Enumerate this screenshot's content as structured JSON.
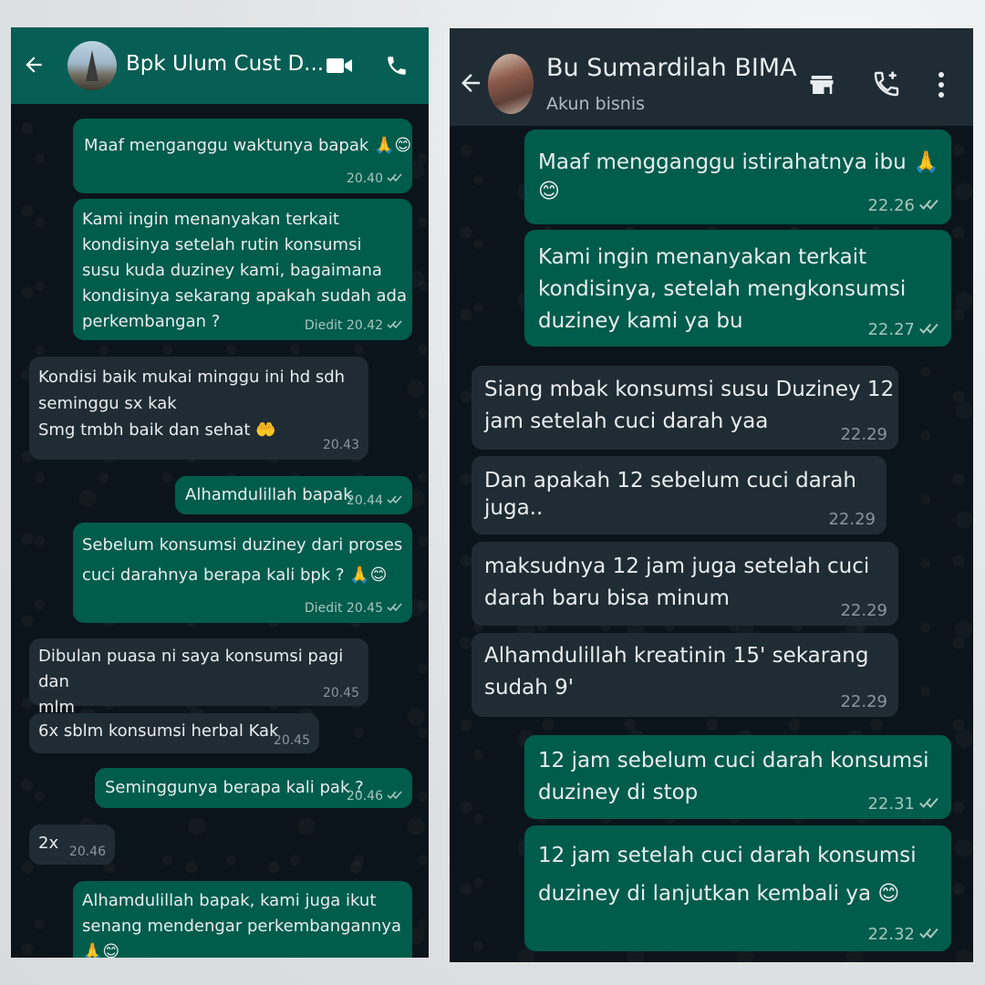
{
  "left_chat": {
    "contact_name": "Bpk Ulum Cust D...",
    "header_icons": [
      "back-arrow-icon",
      "video-call-icon",
      "phone-icon"
    ],
    "messages": [
      {
        "dir": "out",
        "text": "Maaf menganggu waktunya bapak 🙏😊",
        "time": "20.40",
        "ticks": true
      },
      {
        "dir": "out",
        "text": "Kami ingin menanyakan terkait\nkondisinya setelah rutin konsumsi\nsusu kuda duziney kami, bagaimana\nkondisinya sekarang apakah sudah ada\nperkembangan ?",
        "time": "Diedit 20.42",
        "ticks": true
      },
      {
        "dir": "in",
        "text": "Kondisi baik mukai minggu ini hd sdh\nseminggu sx kak\nSmg tmbh baik dan sehat 🤲",
        "time": "20.43"
      },
      {
        "dir": "out",
        "text": "Alhamdulillah bapak",
        "time": "20.44",
        "ticks": true
      },
      {
        "dir": "out",
        "text": "Sebelum konsumsi duziney dari proses\ncuci darahnya berapa kali bpk ? 🙏😊",
        "time": "Diedit 20.45",
        "ticks": true
      },
      {
        "dir": "in",
        "text": "Dibulan puasa ni saya konsumsi pagi dan\nmlm",
        "time": "20.45"
      },
      {
        "dir": "in",
        "text": "6x sblm konsumsi herbal Kak",
        "time": "20.45"
      },
      {
        "dir": "out",
        "text": "Seminggunya berapa kali pak ?",
        "time": "20.46",
        "ticks": true
      },
      {
        "dir": "in",
        "text": "2x",
        "time": "20.46"
      },
      {
        "dir": "out",
        "text": "Alhamdulillah bapak, kami juga ikut\nsenang mendengar perkembangannya\n🙏😊",
        "time": ""
      }
    ]
  },
  "right_chat": {
    "contact_name": "Bu Sumardilah BIMA",
    "subtitle": "Akun bisnis",
    "header_icons": [
      "back-arrow-icon",
      "store-icon",
      "add-call-icon",
      "more-vert-icon"
    ],
    "messages": [
      {
        "dir": "out",
        "text": "Maaf mengganggu istirahatnya ibu 🙏😊",
        "time": "22.26",
        "ticks": true
      },
      {
        "dir": "out",
        "text": "Kami ingin menanyakan terkait\nkondisinya, setelah mengkonsumsi\nduziney kami ya bu",
        "time": "22.27",
        "ticks": true
      },
      {
        "dir": "in",
        "text": "Siang mbak konsumsi susu Duziney 12\njam setelah cuci darah yaa",
        "time": "22.29"
      },
      {
        "dir": "in",
        "text": "Dan apakah 12 sebelum cuci darah juga..",
        "time": "22.29"
      },
      {
        "dir": "in",
        "text": "maksudnya 12 jam juga setelah cuci\ndarah baru bisa minum",
        "time": "22.29"
      },
      {
        "dir": "in",
        "text": "Alhamdulillah kreatinin 15' sekarang\nsudah 9'",
        "time": "22.29"
      },
      {
        "dir": "out",
        "text": "12 jam sebelum cuci darah konsumsi\nduziney di stop",
        "time": "22.31",
        "ticks": true
      },
      {
        "dir": "out",
        "text": "12 jam setelah cuci darah konsumsi\nduziney di lanjutkan kembali ya 😊",
        "time": "22.32",
        "ticks": true
      }
    ]
  },
  "colors": {
    "left_header": "#075e54",
    "right_header": "#1f2c34",
    "outgoing_bubble": "#005c4b",
    "incoming_bubble": "#202c33",
    "chat_background": "#0b141a"
  }
}
